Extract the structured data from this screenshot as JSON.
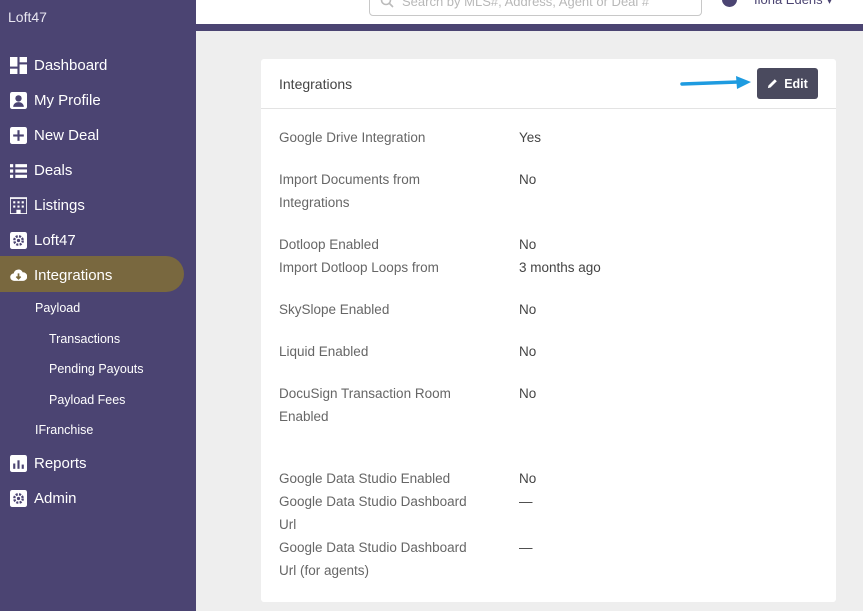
{
  "sidebar": {
    "brand": "Loft47",
    "items": [
      {
        "label": "Dashboard",
        "icon": "dashboard-icon"
      },
      {
        "label": "My Profile",
        "icon": "profile-icon"
      },
      {
        "label": "New Deal",
        "icon": "plus-square-icon"
      },
      {
        "label": "Deals",
        "icon": "list-icon"
      },
      {
        "label": "Listings",
        "icon": "building-icon"
      },
      {
        "label": "Loft47",
        "icon": "gear-square-icon"
      },
      {
        "label": "Integrations",
        "icon": "cloud-download-icon"
      },
      {
        "label": "Reports",
        "icon": "bar-chart-icon"
      },
      {
        "label": "Admin",
        "icon": "gear-square-icon"
      }
    ],
    "subitems": [
      "Payload",
      "Transactions",
      "Pending Payouts",
      "Payload Fees",
      "IFranchise"
    ]
  },
  "topbar": {
    "search_placeholder": "Search by MLS#, Address, Agent or Deal #",
    "user_name": "Ilona Edens ▾"
  },
  "card": {
    "title": "Integrations",
    "edit_label": "Edit",
    "rows": [
      {
        "label": "Google Drive Integration",
        "value": "Yes"
      },
      {
        "label": "Import Documents from Integrations",
        "value": "No"
      },
      {
        "label": "Dotloop Enabled",
        "value": "No"
      },
      {
        "label": "Import Dotloop Loops from",
        "value": "3 months ago"
      },
      {
        "label": "SkySlope Enabled",
        "value": "No"
      },
      {
        "label": "Liquid Enabled",
        "value": "No"
      },
      {
        "label": "DocuSign Transaction Room Enabled",
        "value": "No"
      },
      {
        "label": "Google Data Studio Enabled",
        "value": "No"
      },
      {
        "label": "Google Data Studio Dashboard Url",
        "value": "—"
      },
      {
        "label": "Google Data Studio Dashboard Url (for agents)",
        "value": "—"
      }
    ]
  },
  "colors": {
    "sidebar": "#4b4472",
    "highlight": "#7b6a3c",
    "edit_button": "#4a4a5e",
    "arrow": "#1e9be0"
  }
}
